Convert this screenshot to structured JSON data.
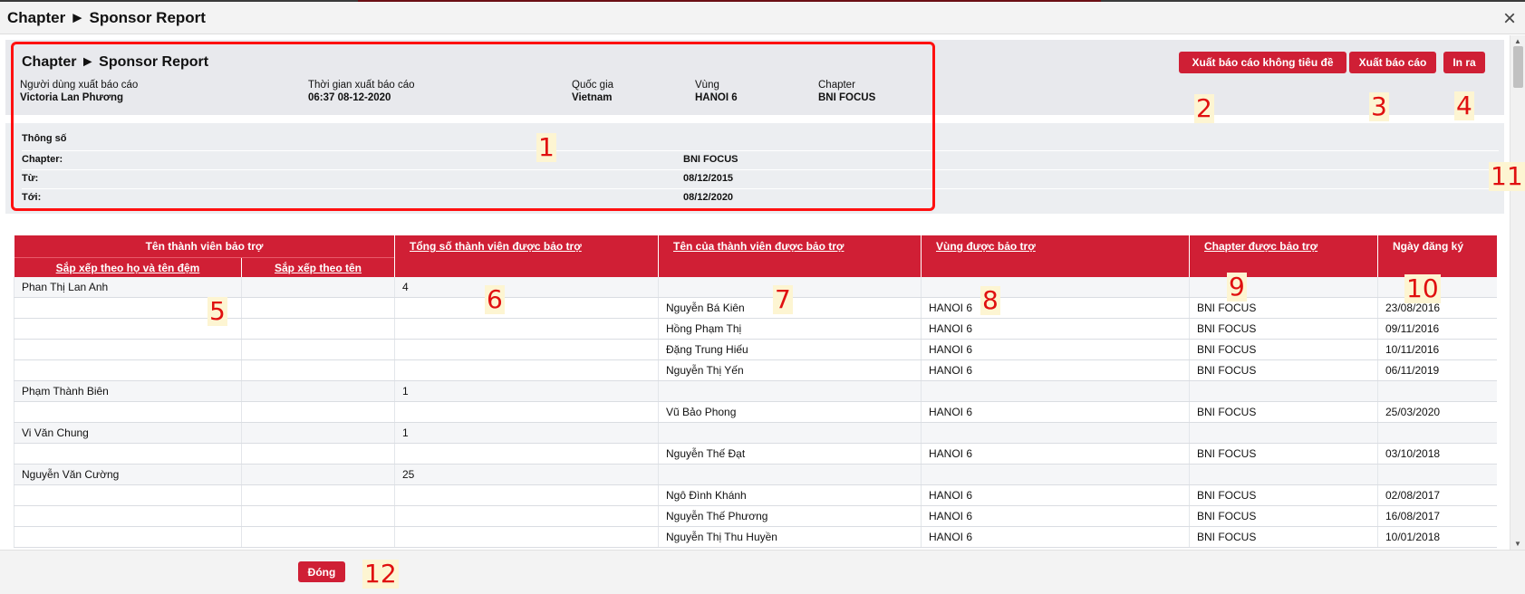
{
  "modal": {
    "title": "Chapter ► Sponsor Report",
    "close": "×"
  },
  "header": {
    "title": "Chapter ► Sponsor Report",
    "fields": [
      {
        "label": "Người dùng xuất báo cáo",
        "value": "Victoria Lan Phương"
      },
      {
        "label": "Thời gian xuất báo cáo",
        "value": "06:37 08-12-2020"
      },
      {
        "label": "Quốc gia",
        "value": "Vietnam"
      },
      {
        "label": "Vùng",
        "value": "HANOI 6"
      },
      {
        "label": "Chapter",
        "value": "BNI FOCUS"
      }
    ],
    "buttons": {
      "export_no_title": "Xuất báo cáo không tiêu đề",
      "export": "Xuất báo cáo",
      "print": "In ra"
    }
  },
  "params": {
    "title": "Thông số",
    "rows": [
      {
        "label": "Chapter:",
        "value": "BNI FOCUS"
      },
      {
        "label": "Từ:",
        "value": "08/12/2015"
      },
      {
        "label": "Tới:",
        "value": "08/12/2020"
      }
    ]
  },
  "table": {
    "headers": {
      "sponsor_name": "Tên thành viên bảo trợ",
      "sort_full": "Sắp xếp theo họ và tên đệm",
      "sort_first": "Sắp xếp theo tên",
      "total": "Tổng số thành viên được bảo trợ",
      "sponsored_name": "Tên của thành viên được bảo trợ",
      "region": "Vùng được bảo trợ",
      "chapter": "Chapter được bảo trợ",
      "date": "Ngày đăng ký"
    },
    "groups": [
      {
        "sponsor": "Phan Thị Lan Anh",
        "total": "4",
        "members": [
          {
            "name": "Nguyễn Bá Kiên",
            "region": "HANOI 6",
            "chapter": "BNI FOCUS",
            "date": "23/08/2016"
          },
          {
            "name": "Hồng Phạm Thị",
            "region": "HANOI 6",
            "chapter": "BNI FOCUS",
            "date": "09/11/2016"
          },
          {
            "name": "Đặng Trung Hiếu",
            "region": "HANOI 6",
            "chapter": "BNI FOCUS",
            "date": "10/11/2016"
          },
          {
            "name": "Nguyễn Thị Yến",
            "region": "HANOI 6",
            "chapter": "BNI FOCUS",
            "date": "06/11/2019"
          }
        ]
      },
      {
        "sponsor": "Phạm Thành Biên",
        "total": "1",
        "members": [
          {
            "name": "Vũ Bảo Phong",
            "region": "HANOI 6",
            "chapter": "BNI FOCUS",
            "date": "25/03/2020"
          }
        ]
      },
      {
        "sponsor": "Vi Văn Chung",
        "total": "1",
        "members": [
          {
            "name": "Nguyễn Thế Đạt",
            "region": "HANOI 6",
            "chapter": "BNI FOCUS",
            "date": "03/10/2018"
          }
        ]
      },
      {
        "sponsor": "Nguyễn Văn Cường",
        "total": "25",
        "members": [
          {
            "name": "Ngô Đình  Khánh",
            "region": "HANOI 6",
            "chapter": "BNI FOCUS",
            "date": "02/08/2017"
          },
          {
            "name": "Nguyễn Thế Phương",
            "region": "HANOI 6",
            "chapter": "BNI FOCUS",
            "date": "16/08/2017"
          },
          {
            "name": "Nguyễn Thị Thu Huyền",
            "region": "HANOI 6",
            "chapter": "BNI FOCUS",
            "date": "10/01/2018"
          }
        ]
      }
    ]
  },
  "footer": {
    "close": "Đóng"
  },
  "annotations": [
    "1",
    "2",
    "3",
    "4",
    "5",
    "6",
    "7",
    "8",
    "9",
    "10",
    "11",
    "12"
  ],
  "colors": {
    "accent": "#d01f35",
    "annotation": "#e01010"
  }
}
